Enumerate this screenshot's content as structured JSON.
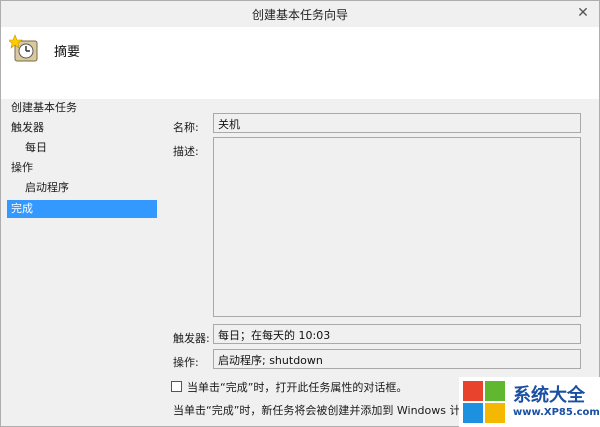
{
  "window": {
    "title": "创建基本任务向导",
    "close_glyph": "✕"
  },
  "header": {
    "title": "摘要",
    "icon": "scheduled-task-clock-icon"
  },
  "sidebar": {
    "items": [
      {
        "label": "创建基本任务",
        "level": 0,
        "active": false
      },
      {
        "label": "触发器",
        "level": 0,
        "active": false
      },
      {
        "label": "每日",
        "level": 1,
        "active": false
      },
      {
        "label": "操作",
        "level": 0,
        "active": false
      },
      {
        "label": "启动程序",
        "level": 1,
        "active": false
      },
      {
        "label": "完成",
        "level": 0,
        "active": true
      }
    ]
  },
  "form": {
    "name_label": "名称:",
    "name_value": "关机",
    "desc_label": "描述:",
    "desc_value": "",
    "trigger_label": "触发器:",
    "trigger_value": "每日；在每天的 10:03",
    "action_label": "操作:",
    "action_value": "启动程序; shutdown",
    "checkbox_label": "当单击“完成”时，打开此任务属性的对话框。",
    "checkbox_checked": false,
    "note": "当单击“完成”时，新任务将会被创建并添加到 Windows 计划中"
  },
  "watermark": {
    "text": "系统大全",
    "url": "www.XP85.com"
  },
  "colors": {
    "accent": "#3399ff",
    "header_bg": "#ffffff",
    "window_bg": "#f0f0f0"
  }
}
